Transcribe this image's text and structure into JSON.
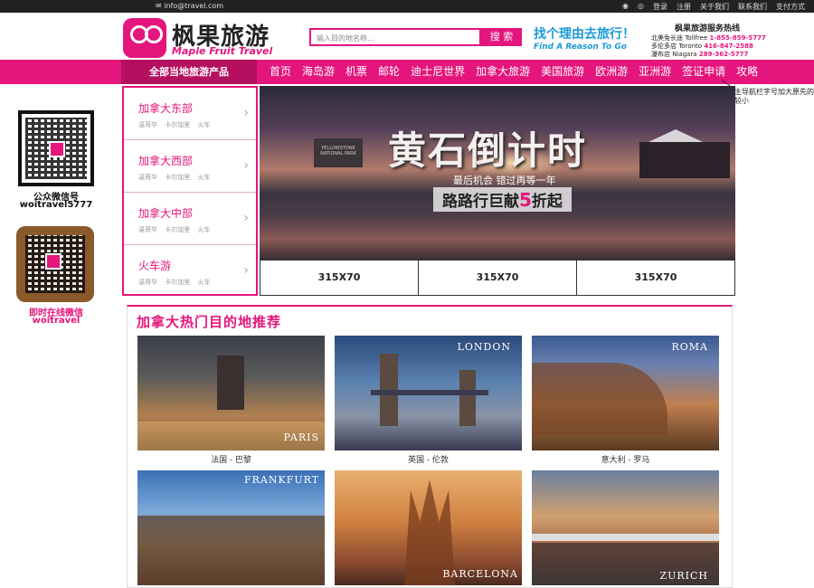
{
  "topbar": {
    "email": "info@travel.com",
    "links": [
      "登录",
      "注册",
      "关于我们",
      "联系我们",
      "支付方式"
    ]
  },
  "header": {
    "logo_cn": "枫果旅游",
    "logo_en": "Maple Fruit Travel",
    "search_placeholder": "输入目的地名称...",
    "search_button": "搜 索",
    "slogan_cn": "找个理由去旅行！",
    "slogan_en": "Find A Reason To Go",
    "hotline_title": "枫果旅游服务热线",
    "hotline_rows": [
      {
        "label": "北美免长途 Tollfree",
        "number": "1-855-859-5777"
      },
      {
        "label": "多伦多店 Toronto",
        "number": "416-847-2588"
      },
      {
        "label": "瀑布店 Niagara",
        "number": "289-362-5777"
      }
    ]
  },
  "nav": {
    "all_categories": "全部当地旅游产品",
    "items": [
      "首页",
      "海岛游",
      "机票",
      "邮轮",
      "迪士尼世界",
      "加拿大旅游",
      "美国旅游",
      "欧洲游",
      "亚洲游",
      "签证申请",
      "攻略"
    ],
    "note": "主导航栏字号加大原先的较小"
  },
  "side": {
    "qr1_label": "公众微信号",
    "qr1_id": "woitravel5777",
    "qr2_label": "即时在线微信",
    "qr2_id": "woitravel"
  },
  "categories": [
    {
      "title": "加拿大东部",
      "sub": "温哥华 卡尔加里 火车"
    },
    {
      "title": "加拿大西部",
      "sub": "温哥华 卡尔加里 火车"
    },
    {
      "title": "加拿大中部",
      "sub": "温哥华 卡尔加里 火车"
    },
    {
      "title": "火车游",
      "sub": "温哥华 卡尔加里 火车"
    }
  ],
  "banner": {
    "sign": "YELLOWSTONE NATIONAL PARK",
    "headline": "黄石倒计时",
    "subline": "最后机会 错过再等一年",
    "promo_prefix": "路路行巨献",
    "promo_number": "5",
    "promo_suffix": "折起"
  },
  "small_ads": [
    "315X70",
    "315X70",
    "315X70"
  ],
  "recommend": {
    "title": "加拿大热门目的地推荐",
    "cards": [
      {
        "city": "PARIS",
        "caption": "法国 - 巴黎"
      },
      {
        "city": "LONDON",
        "caption": "英国 - 伦敦"
      },
      {
        "city": "ROMA",
        "caption": "意大利 - 罗马"
      },
      {
        "city": "FRANKFURT",
        "caption": ""
      },
      {
        "city": "BARCELONA",
        "caption": ""
      },
      {
        "city": "ZURICH",
        "caption": ""
      }
    ]
  },
  "colors": {
    "brand": "#e4157c",
    "nav_dark": "#b5105f",
    "topbar": "#222222"
  }
}
